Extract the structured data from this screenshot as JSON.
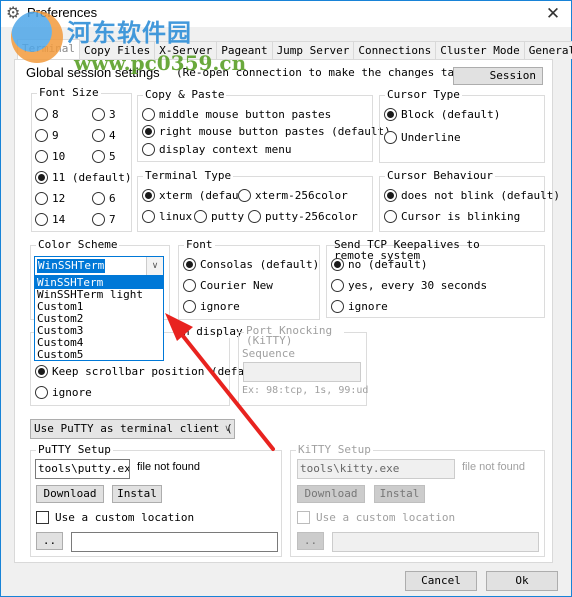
{
  "window": {
    "title": "Preferences",
    "close_glyph": "✕",
    "app_icon": "⚙"
  },
  "watermark": {
    "site_name": "河东软件园",
    "url": "www.pc0359.cn"
  },
  "tabs": [
    {
      "label": "Terminal",
      "active": true
    },
    {
      "label": "Copy Files",
      "active": false
    },
    {
      "label": "X-Server",
      "active": false
    },
    {
      "label": "Pageant",
      "active": false
    },
    {
      "label": "Jump Server",
      "active": false
    },
    {
      "label": "Connections",
      "active": false
    },
    {
      "label": "Cluster Mode",
      "active": false
    },
    {
      "label": "General",
      "active": false
    }
  ],
  "header": {
    "title": "Global session settings",
    "note": "(Re-open connection to make the changes take effect)",
    "session_button": "Session"
  },
  "font_size": {
    "legend": "Font Size",
    "options": [
      {
        "label": "8",
        "checked": false
      },
      {
        "label": "3",
        "checked": false
      },
      {
        "label": "9",
        "checked": false
      },
      {
        "label": "4",
        "checked": false
      },
      {
        "label": "10",
        "checked": false
      },
      {
        "label": "5",
        "checked": false
      },
      {
        "label": "11 (default)",
        "checked": true
      },
      {
        "label": "12",
        "checked": false
      },
      {
        "label": "6",
        "checked": false
      },
      {
        "label": "14",
        "checked": false
      },
      {
        "label": "7",
        "checked": false
      }
    ]
  },
  "copy_paste": {
    "legend": "Copy & Paste",
    "options": [
      {
        "label": "middle mouse button pastes",
        "checked": false
      },
      {
        "label": "right mouse button pastes (default)",
        "checked": true
      },
      {
        "label": "display context menu",
        "checked": false
      }
    ]
  },
  "cursor_type": {
    "legend": "Cursor Type",
    "options": [
      {
        "label": "Block (default)",
        "checked": true
      },
      {
        "label": "Underline",
        "checked": false
      }
    ]
  },
  "terminal_type": {
    "legend": "Terminal Type",
    "options": [
      {
        "label": "xterm (defaul",
        "checked": true
      },
      {
        "label": "xterm-256color",
        "checked": false
      },
      {
        "label": "linux",
        "checked": false
      },
      {
        "label": "putty",
        "checked": false
      },
      {
        "label": "putty-256color",
        "checked": false
      }
    ]
  },
  "cursor_behaviour": {
    "legend": "Cursor Behaviour",
    "options": [
      {
        "label": "does not blink (default)",
        "checked": true
      },
      {
        "label": "Cursor is blinking",
        "checked": false
      }
    ]
  },
  "color_scheme": {
    "legend": "Color Scheme",
    "selected": "WinSSHTerm",
    "dropdown_glyph": "∨",
    "options": [
      "WinSSHTerm",
      "WinSSHTerm light",
      "Custom1",
      "Custom2",
      "Custom3",
      "Custom4",
      "Custom5"
    ]
  },
  "font": {
    "legend": "Font",
    "options": [
      {
        "label": "Consolas (default)",
        "checked": true
      },
      {
        "label": "Courier New",
        "checked": false
      },
      {
        "label": "ignore",
        "checked": false
      }
    ]
  },
  "keepalives": {
    "legend": "Send TCP Keepalives to remote system",
    "options": [
      {
        "label": "no (default)",
        "checked": true
      },
      {
        "label": "yes, every 30 seconds",
        "checked": false
      },
      {
        "label": "ignore",
        "checked": false
      }
    ]
  },
  "scroll_display": {
    "legend_partial": "n display",
    "options": [
      {
        "label": "Keep scrollbar position (defau",
        "checked": true
      },
      {
        "label": "ignore",
        "checked": false
      }
    ]
  },
  "port_knocking": {
    "legend": "Port Knocking (KiTTY)",
    "label": "Sequence",
    "value": "",
    "hint": "Ex: 98:tcp, 1s, 99:ud"
  },
  "terminal_client": {
    "selected": "Use PuTTY as terminal client (",
    "dropdown_glyph": "∨"
  },
  "putty_setup": {
    "legend": "PuTTY Setup",
    "path": "tools\\putty.exe",
    "status": "file not found",
    "download_label": "Download",
    "install_label": "Instal",
    "custom_location_label": "Use a custom location",
    "custom_location_checked": false,
    "browse_label": "..",
    "custom_path": ""
  },
  "kitty_setup": {
    "legend": "KiTTY Setup",
    "path": "tools\\kitty.exe",
    "status": "file not found",
    "download_label": "Download",
    "install_label": "Instal",
    "custom_location_label": "Use a custom location",
    "custom_location_checked": false,
    "browse_label": "..",
    "custom_path": ""
  },
  "footer": {
    "cancel_label": "Cancel",
    "ok_label": "Ok"
  },
  "colors": {
    "accent": "#0078d7",
    "window_border": "#1883d7",
    "annotation_arrow": "#e8231f"
  }
}
